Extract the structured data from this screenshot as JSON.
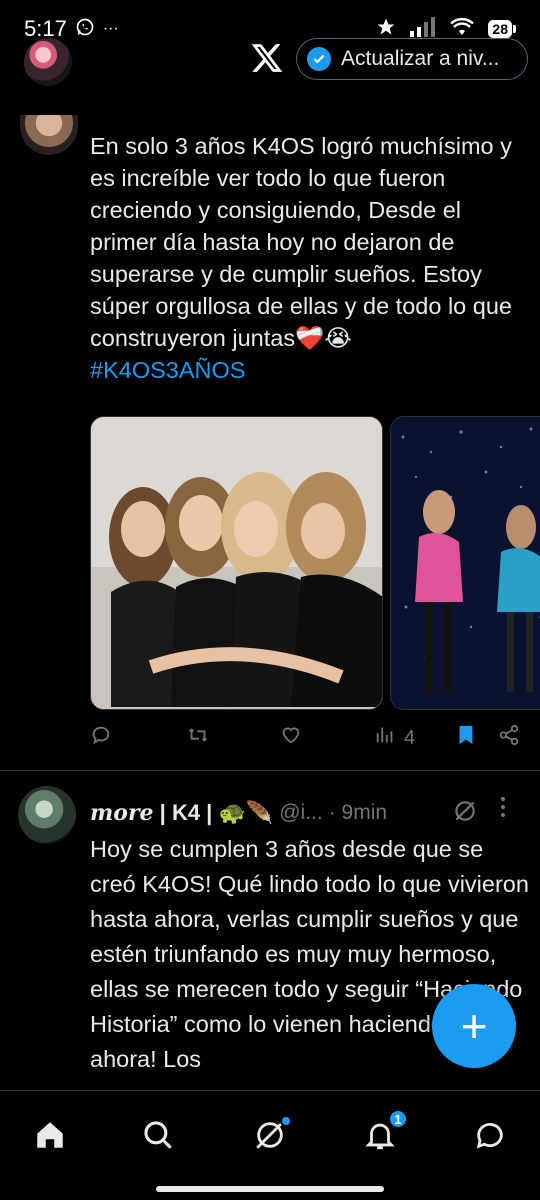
{
  "status_bar": {
    "time": "5:17",
    "menu_dots": "···",
    "battery": "28"
  },
  "header": {
    "upgrade_label": "Actualizar a niv..."
  },
  "post1": {
    "text": "En solo 3 años K4OS logró muchísimo y es increíble ver todo lo que fueron creciendo y consiguiendo, Desde el primer día hasta hoy no dejaron de superarse y de cumplir sueños. Estoy súper orgullosa de ellas y de todo lo que construyeron juntas❤️‍🩹😭",
    "hashtag": "#K4OS3AÑOS",
    "views": "4"
  },
  "post2": {
    "name": "more",
    "name_suffix": "| K4 | 🐢🪶",
    "handle": "@i...",
    "time": "· 9min",
    "text": "Hoy se cumplen 3 años desde que se creó K4OS! Qué lindo todo lo que vivieron hasta ahora, verlas cumplir sueños y que estén triunfando es muy muy hermoso, ellas se merecen todo y seguir “Haciendo Historia” como lo vienen haciendo hasta ahora! Los"
  },
  "fab": {
    "label": "+"
  },
  "bottom_nav": {
    "notifications_badge": "1"
  },
  "colors": {
    "accent": "#1d9bf0",
    "background": "#000000",
    "muted": "#71767b",
    "text": "#e7e9ea"
  }
}
